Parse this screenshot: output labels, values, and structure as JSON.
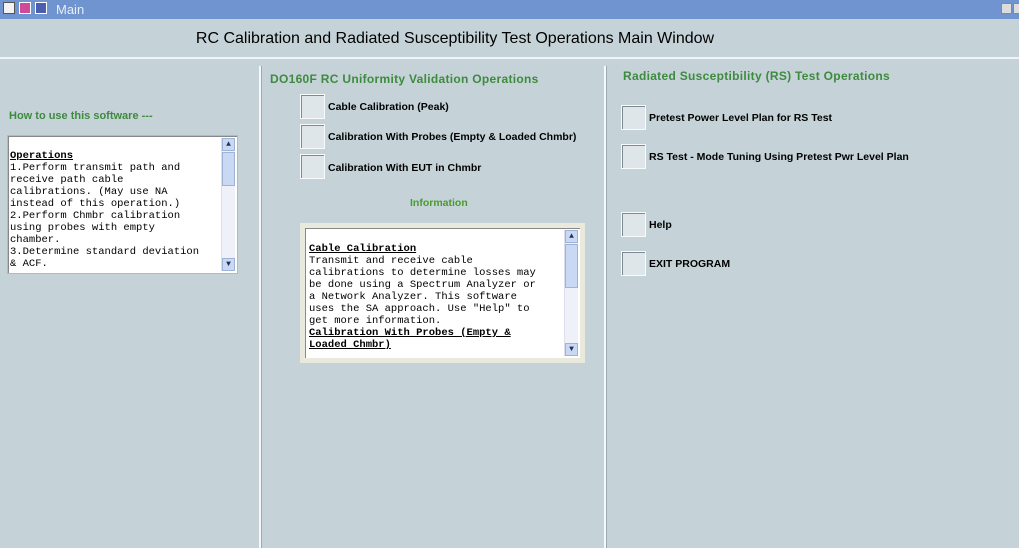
{
  "window": {
    "title": "Main"
  },
  "header": {
    "title": "RC Calibration and Radiated Susceptibility Test Operations Main Window"
  },
  "left": {
    "heading": "How to use this software ---",
    "operations_box": {
      "lines": [
        "Operations",
        "1.Perform transmit path and",
        "receive path cable",
        "calibrations. (May use NA",
        "instead of this operation.)",
        "2.Perform Chmbr calibration",
        "using probes with empty",
        "chamber.",
        "3.Determine standard deviation",
        "& ACF."
      ]
    }
  },
  "middle": {
    "title": "DO160F RC Uniformity Validation Operations",
    "options": [
      "Cable Calibration (Peak)",
      "Calibration With Probes (Empty & Loaded Chmbr)",
      "Calibration With EUT in Chmbr"
    ],
    "info_label": "Information",
    "info_box": {
      "lines": [
        "Cable Calibration",
        "Transmit and receive cable",
        "calibrations to determine losses may",
        "be done using a Spectrum Analyzer or",
        "a Network Analyzer. This software",
        "uses the SA approach. Use \"Help\" to",
        "get more information.",
        "Calibration With Probes (Empty &",
        "Loaded Chmbr)"
      ]
    }
  },
  "right": {
    "title": "Radiated Susceptibility (RS) Test Operations",
    "options": [
      "Pretest Power Level Plan for RS Test",
      "RS Test - Mode Tuning Using Pretest Pwr Level Plan",
      "Help",
      "EXIT PROGRAM"
    ]
  }
}
